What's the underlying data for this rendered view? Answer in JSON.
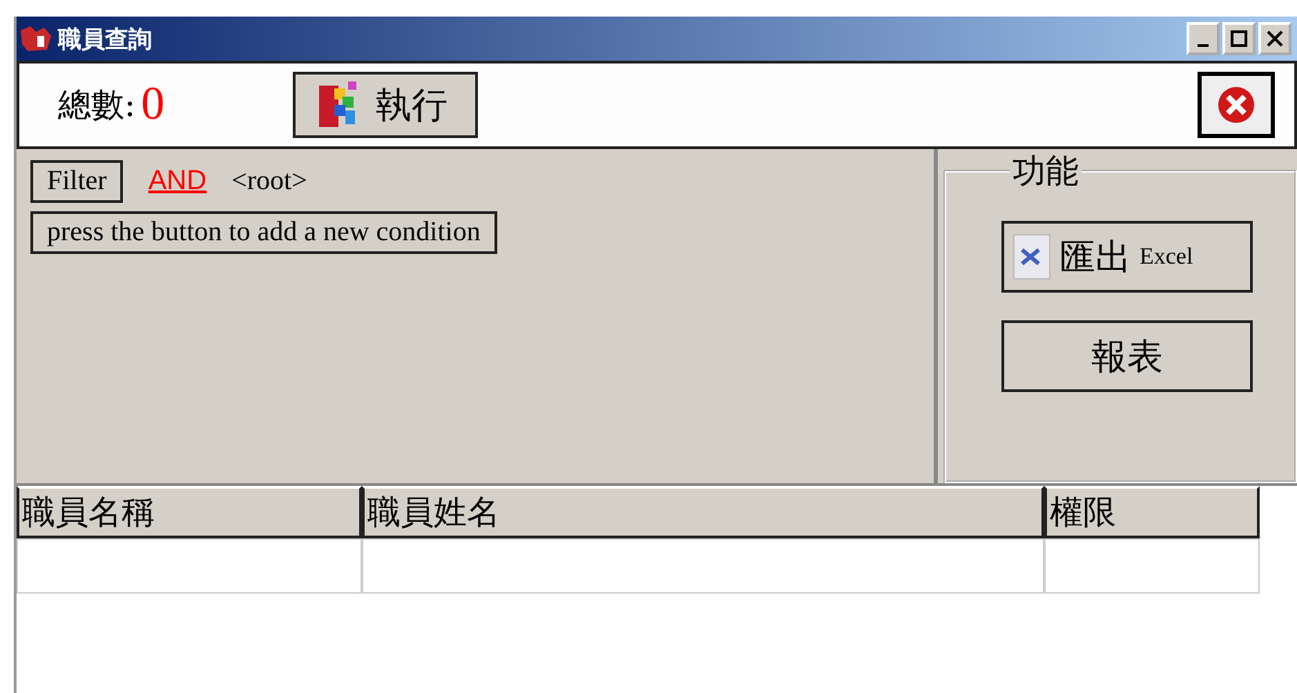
{
  "window": {
    "title": "職員查詢"
  },
  "toolbar": {
    "total_label": "總數:",
    "total_value": "0",
    "run_button": "執行"
  },
  "filter": {
    "button": "Filter",
    "operator": "AND",
    "node": "<root>",
    "hint": "press the button to add a new condition"
  },
  "functions": {
    "title": "功能",
    "buttons": [
      {
        "kind": "excel",
        "label": "匯出",
        "suffix": "Excel"
      },
      {
        "kind": "plain",
        "label": "報表"
      }
    ]
  },
  "table": {
    "columns": [
      "職員名稱",
      "職員姓名",
      "權限"
    ],
    "rows": [
      [
        "",
        "",
        ""
      ]
    ]
  }
}
